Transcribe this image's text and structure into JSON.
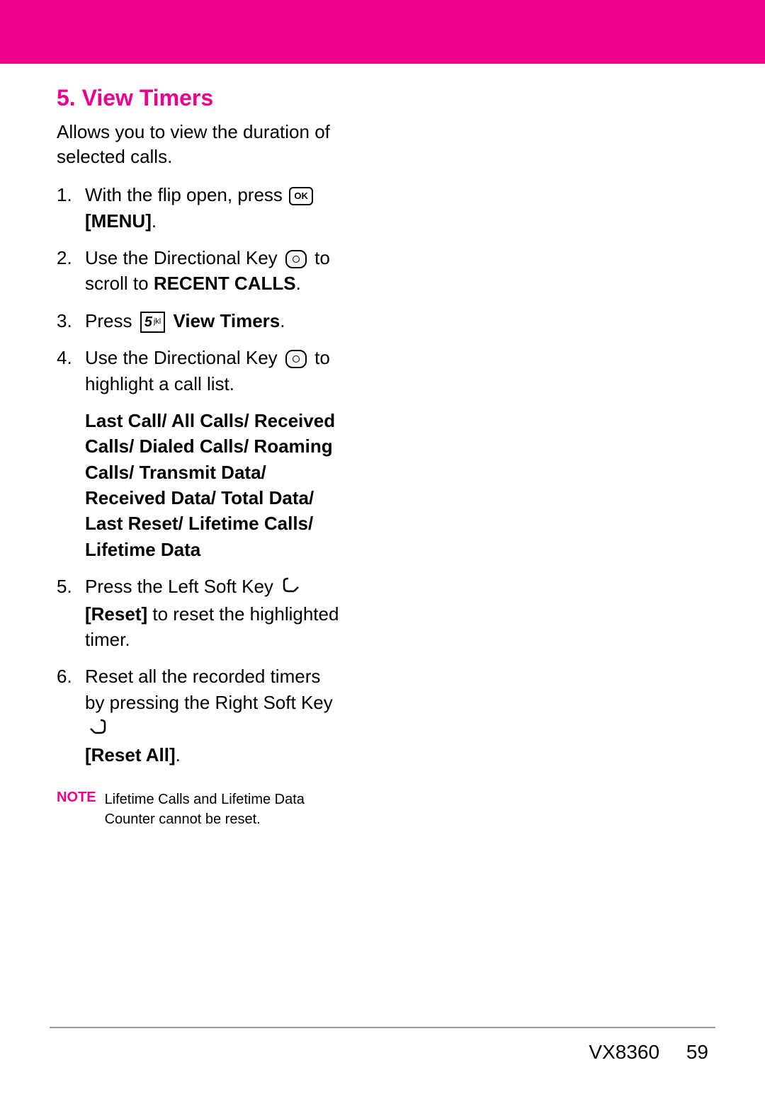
{
  "heading": "5. View Timers",
  "intro": "Allows you to view the duration of selected calls.",
  "steps": {
    "s1a": "With the flip open, press",
    "s1b": "[MENU]",
    "s1b_suffix": ".",
    "s2a": "Use the Directional Key",
    "s2b": "to scroll to ",
    "s2c": "RECENT CALLS",
    "s2c_suffix": ".",
    "s3a": "Press",
    "s3b": "View Timers",
    "s3b_suffix": ".",
    "s4a": "Use the Directional Key",
    "s4b": "to highlight a call list.",
    "s4list": "Last Call/ All Calls/ Received Calls/ Dialed Calls/ Roaming Calls/ Transmit Data/ Received Data/ Total Data/ Last Reset/ Lifetime Calls/ Lifetime Data",
    "s5a": "Press the Left Soft Key",
    "s5b": "[Reset]",
    "s5c": " to reset the highlighted timer.",
    "s6a": "Reset all the recorded timers by pressing the Right Soft Key",
    "s6b": "[Reset All]",
    "s6b_suffix": "."
  },
  "icons": {
    "ok": "OK",
    "key5num": "5",
    "key5letters": "jkl"
  },
  "note": {
    "label": "NOTE",
    "text": "Lifetime Calls and Lifetime Data Counter cannot be reset."
  },
  "footer": {
    "model": "VX8360",
    "page": "59"
  }
}
